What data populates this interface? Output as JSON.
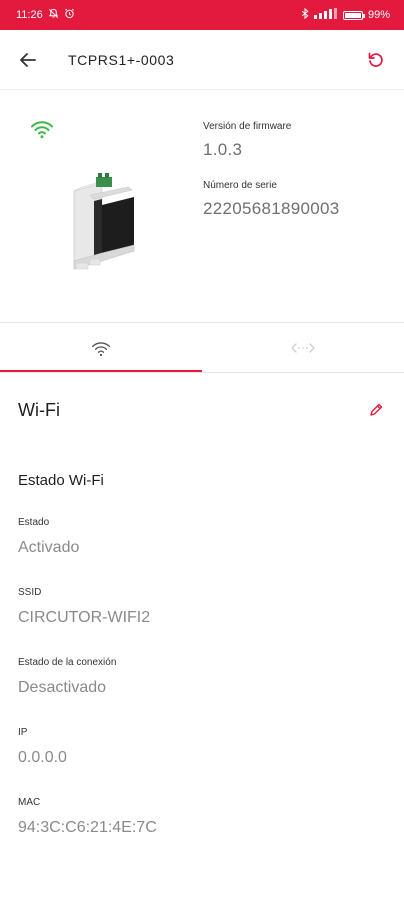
{
  "status_bar": {
    "time": "11:26",
    "battery": "99",
    "battery_fraction": 0.99,
    "icons": [
      "bell-off-icon",
      "alarm-icon",
      "bluetooth-icon",
      "signal-icon",
      "battery-icon"
    ]
  },
  "app_bar": {
    "title": "TCPRS1+-0003",
    "back_icon": "arrow-left-icon",
    "refresh_icon": "refresh-icon"
  },
  "device": {
    "firmware_label": "Versión de firmware",
    "firmware_value": "1.0.3",
    "serial_label": "Número de serie",
    "serial_value": "22205681890003",
    "connection_icon": "wifi-icon",
    "colors": {
      "wifi_connected": "#3fb84a"
    }
  },
  "tabs": [
    {
      "icon": "wifi-icon",
      "active": true
    },
    {
      "icon": "ethernet-icon",
      "active": false
    }
  ],
  "wifi": {
    "title": "Wi-Fi",
    "edit_icon": "pencil-icon",
    "status_title": "Estado Wi-Fi",
    "fields": [
      {
        "label": "Estado",
        "value": "Activado"
      },
      {
        "label": "SSID",
        "value": "CIRCUTOR-WIFI2"
      },
      {
        "label": "Estado de la conexión",
        "value": "Desactivado"
      },
      {
        "label": "IP",
        "value": "0.0.0.0"
      },
      {
        "label": "MAC",
        "value": "94:3C:C6:21:4E:7C"
      }
    ]
  },
  "colors": {
    "accent": "#e3193d",
    "text_primary": "#1f1f1f",
    "text_secondary": "#8a8a8a"
  }
}
